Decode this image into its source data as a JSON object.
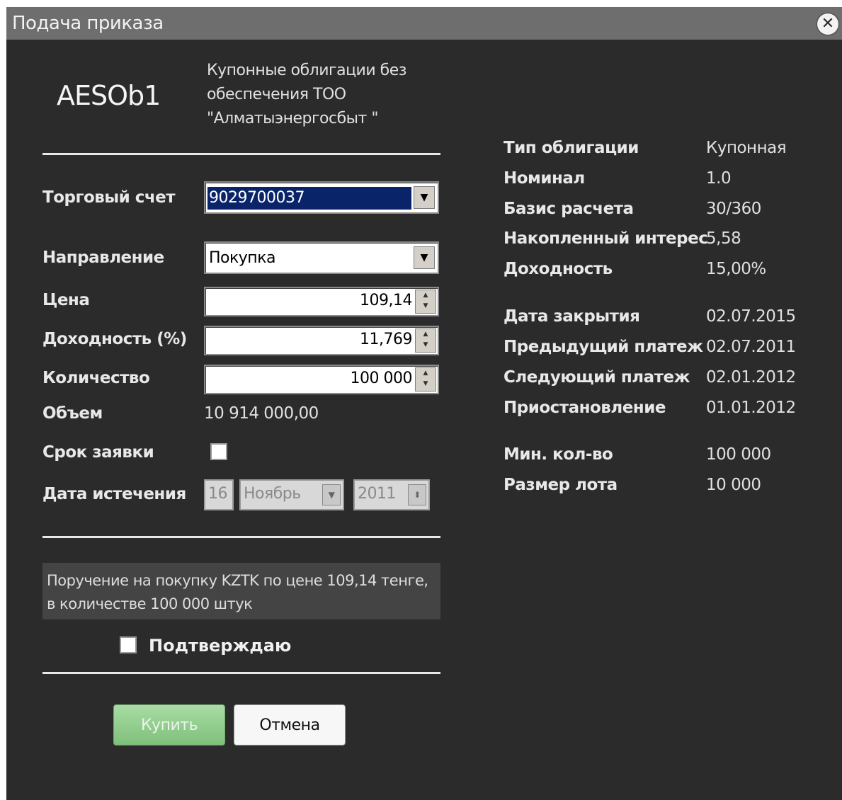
{
  "window": {
    "title": "Подача приказа"
  },
  "instrument": {
    "ticker": "AESOb1",
    "description": "Купонные облигации без обеспечения ТОО \"Алматыэнергосбыт \""
  },
  "form": {
    "account_label": "Торговый счет",
    "account_value": "9029700037",
    "direction_label": "Направление",
    "direction_value": "Покупка",
    "price_label": "Цена",
    "price_value": "109,14",
    "yield_label": "Доходность (%)",
    "yield_value": "11,769",
    "quantity_label": "Количество",
    "quantity_value": "100 000",
    "volume_label": "Объем",
    "volume_value": "10 914 000,00",
    "term_label": "Срок заявки",
    "expiry_label": "Дата истечения",
    "expiry_day": "16",
    "expiry_month": "Ноябрь",
    "expiry_year": "2011"
  },
  "summary": {
    "text": "Поручение на покупку KZTK по цене 109,14 тенге, в количестве 100 000 штук"
  },
  "confirm": {
    "label": "Подтверждаю"
  },
  "buttons": {
    "buy": "Купить",
    "cancel": "Отмена"
  },
  "bond_info": [
    {
      "label": "Тип облигации",
      "value": "Купонная"
    },
    {
      "label": "Номинал",
      "value": "1.0"
    },
    {
      "label": "Базис расчета",
      "value": "30/360"
    },
    {
      "label": "Накопленный интерес",
      "value": "5,58"
    },
    {
      "label": "Доходность",
      "value": "15,00%"
    },
    {
      "label": "Дата закрытия",
      "value": "02.07.2015"
    },
    {
      "label": "Предыдущий платеж",
      "value": "02.07.2011"
    },
    {
      "label": "Следующий платеж",
      "value": "02.01.2012"
    },
    {
      "label": "Приостановление",
      "value": "01.01.2012"
    },
    {
      "label": "Мин. кол-во",
      "value": "100 000"
    },
    {
      "label": "Размер лота",
      "value": "10 000"
    }
  ],
  "icons": {
    "close": "close-icon",
    "dropdown": "chevron-down-icon",
    "spinner": "spinner-arrows-icon"
  }
}
